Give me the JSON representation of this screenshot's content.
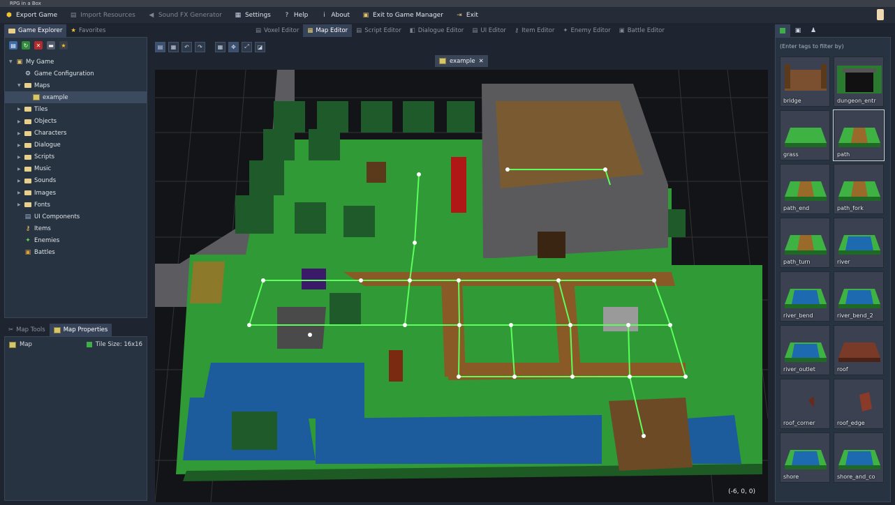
{
  "window": {
    "title": "RPG in a Box"
  },
  "menu": [
    {
      "label": "Export Game",
      "icon": "export-icon",
      "disabled": false
    },
    {
      "label": "Import Resources",
      "icon": "import-icon",
      "disabled": true
    },
    {
      "label": "Sound FX Generator",
      "icon": "speaker-icon",
      "disabled": true
    },
    {
      "label": "Settings",
      "icon": "settings-icon",
      "disabled": false
    },
    {
      "label": "Help",
      "icon": "help-icon",
      "disabled": false
    },
    {
      "label": "About",
      "icon": "info-icon",
      "disabled": false
    },
    {
      "label": "Exit to Game Manager",
      "icon": "game-manager-icon",
      "disabled": false
    },
    {
      "label": "Exit",
      "icon": "exit-icon",
      "disabled": false
    }
  ],
  "left_tabs": [
    {
      "label": "Game Explorer",
      "active": true
    },
    {
      "label": "Favorites",
      "active": false
    }
  ],
  "tree": [
    {
      "label": "My Game",
      "depth": 0,
      "expanded": true,
      "kind": "game"
    },
    {
      "label": "Game Configuration",
      "depth": 1,
      "kind": "gear"
    },
    {
      "label": "Maps",
      "depth": 1,
      "expanded": true,
      "kind": "folder"
    },
    {
      "label": "example",
      "depth": 2,
      "kind": "map",
      "selected": true
    },
    {
      "label": "Tiles",
      "depth": 1,
      "kind": "folder"
    },
    {
      "label": "Objects",
      "depth": 1,
      "kind": "folder"
    },
    {
      "label": "Characters",
      "depth": 1,
      "kind": "folder"
    },
    {
      "label": "Dialogue",
      "depth": 1,
      "kind": "folder"
    },
    {
      "label": "Scripts",
      "depth": 1,
      "kind": "folder"
    },
    {
      "label": "Music",
      "depth": 1,
      "kind": "folder"
    },
    {
      "label": "Sounds",
      "depth": 1,
      "kind": "folder"
    },
    {
      "label": "Images",
      "depth": 1,
      "kind": "folder"
    },
    {
      "label": "Fonts",
      "depth": 1,
      "kind": "folder"
    },
    {
      "label": "UI Components",
      "depth": 1,
      "kind": "list"
    },
    {
      "label": "Items",
      "depth": 1,
      "kind": "key"
    },
    {
      "label": "Enemies",
      "depth": 1,
      "kind": "enemy"
    },
    {
      "label": "Battles",
      "depth": 1,
      "kind": "battle"
    }
  ],
  "bottom_tabs": [
    {
      "label": "Map Tools",
      "active": false
    },
    {
      "label": "Map Properties",
      "active": true
    }
  ],
  "map_properties": {
    "name": "Map",
    "tile_size": "Tile Size: 16x16"
  },
  "editor_tabs": [
    {
      "label": "Voxel Editor",
      "active": false
    },
    {
      "label": "Map Editor",
      "active": true
    },
    {
      "label": "Script Editor",
      "active": false
    },
    {
      "label": "Dialogue Editor",
      "active": false
    },
    {
      "label": "UI Editor",
      "active": false
    },
    {
      "label": "Item Editor",
      "active": false
    },
    {
      "label": "Enemy Editor",
      "active": false
    },
    {
      "label": "Battle Editor",
      "active": false
    }
  ],
  "document_tab": {
    "label": "example",
    "close": "✕"
  },
  "viewport": {
    "coords": "(-6, 0, 0)"
  },
  "tile_filter": {
    "placeholder": "(Enter tags to filter by)"
  },
  "tiles": [
    {
      "name": "bridge",
      "kind": "bridge"
    },
    {
      "name": "dungeon_entr",
      "kind": "dungeon"
    },
    {
      "name": "grass",
      "kind": "grass"
    },
    {
      "name": "path",
      "kind": "path",
      "selected": true
    },
    {
      "name": "path_end",
      "kind": "path"
    },
    {
      "name": "path_fork",
      "kind": "path"
    },
    {
      "name": "path_turn",
      "kind": "path"
    },
    {
      "name": "river",
      "kind": "river"
    },
    {
      "name": "river_bend",
      "kind": "river"
    },
    {
      "name": "river_bend_2",
      "kind": "river"
    },
    {
      "name": "river_outlet",
      "kind": "river"
    },
    {
      "name": "roof",
      "kind": "roof"
    },
    {
      "name": "roof_corner",
      "kind": "roofc"
    },
    {
      "name": "roof_edge",
      "kind": "roofe"
    },
    {
      "name": "shore",
      "kind": "river"
    },
    {
      "name": "shore_and_co",
      "kind": "river"
    }
  ],
  "colors": {
    "grass": "#2fa43a",
    "path": "#8a5a26",
    "water": "#1d5c9a",
    "wall": "#5a5a5c",
    "node": "#55ff55"
  }
}
